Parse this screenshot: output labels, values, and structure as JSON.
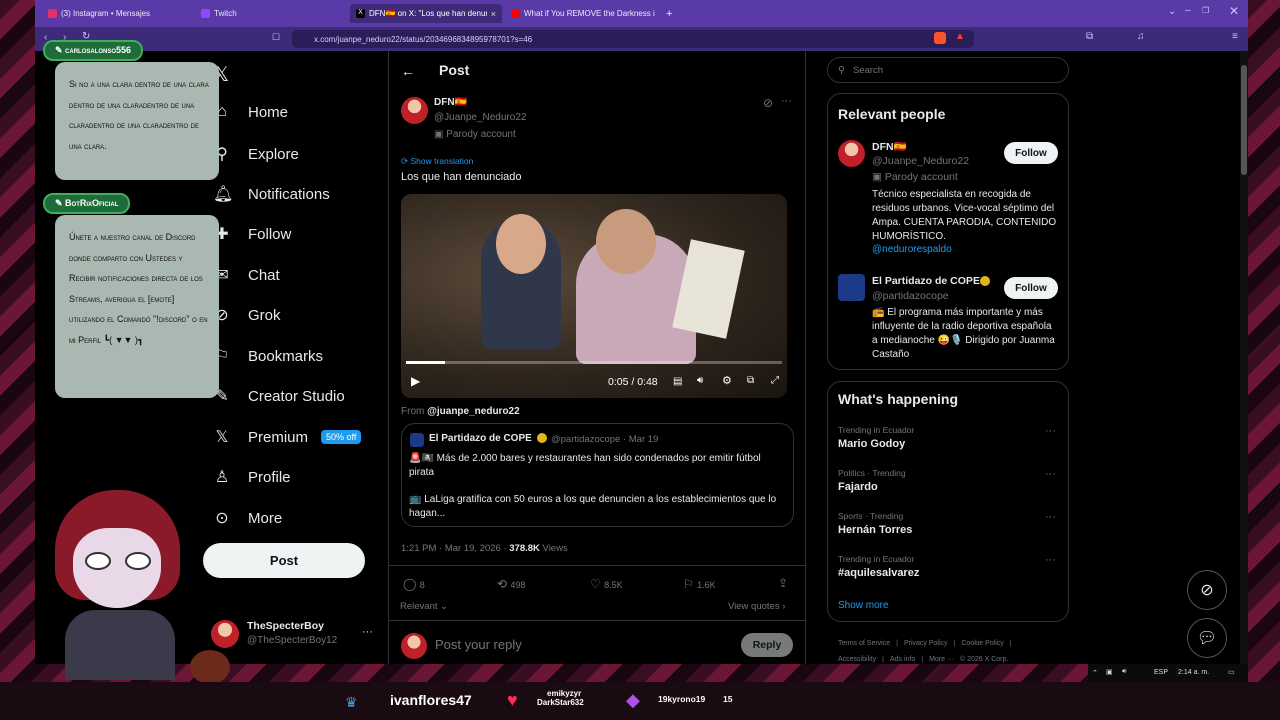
{
  "browser": {
    "tabs": [
      {
        "label": "(3) Instagram • Mensajes",
        "color": "#e1306c"
      },
      {
        "label": "Twitch",
        "color": "#9146ff"
      },
      {
        "label": "DFN🇪🇸 on X: \"Los que han denun",
        "color": "#222222"
      },
      {
        "label": "What if You REMOVE the Darkness in",
        "color": "#ff0000"
      }
    ],
    "new_tab": "+",
    "url": "x.com/juanpe_neduro22/status/2034696834895978701?s=46"
  },
  "nav": {
    "items": [
      "Home",
      "Explore",
      "Notifications",
      "Follow",
      "Chat",
      "Grok",
      "Bookmarks",
      "Creator Studio",
      "Premium",
      "Profile",
      "More"
    ],
    "premium_badge": "50% off",
    "post_button": "Post",
    "account_name": "TheSpecterBoy",
    "account_handle": "@TheSpecterBoy12"
  },
  "post": {
    "header": "Post",
    "author_name": "DFN🇪🇸",
    "author_handle": "@Juanpe_Neduro22",
    "parody": "Parody account",
    "show_translation": "Show translation",
    "text": "Los que han denunciado",
    "video_time": "0:05 / 0:48",
    "video_progress": 0.104,
    "from_label": "From",
    "from_handle": "@juanpe_neduro22",
    "quote": {
      "name": "El Partidazo de COPE",
      "handle": "@partidazocope · Mar 19",
      "line1": "🚨🏴‍☠️ Más de 2.000 bares y restaurantes han sido condenados por emitir fútbol pirata",
      "line2": "📺 LaLiga gratifica con 50 euros a los que denuncien a los establecimientos que lo hagan..."
    },
    "timestamp": "1:21 PM · Mar 19, 2026 ·",
    "views_count": "378.8K",
    "views_label": "Views",
    "replies": "8",
    "reposts": "498",
    "likes": "8.5K",
    "bookmarks": "1.6K",
    "relevant": "Relevant",
    "view_quotes": "View quotes",
    "reply_placeholder": "Post your reply",
    "reply_button": "Reply"
  },
  "sidebar": {
    "search_placeholder": "Search",
    "relevant_title": "Relevant people",
    "people": [
      {
        "name": "DFN🇪🇸",
        "handle": "@Juanpe_Neduro22",
        "sub": "Parody account",
        "bio": "Técnico especialista en recogida de residuos urbanos. Vice-vocal séptimo del Ampa. CUENTA PARODIA, CONTENIDO HUMORÍSTICO.",
        "link": "@nedurorespaldo",
        "follow": "Follow"
      },
      {
        "name": "El Partidazo de COPE",
        "handle": "@partidazocope",
        "bio": "📻 El programa más importante y más influyente de la radio deportiva española a medianoche 😜🎙️ Dirigido por Juanma Castaño",
        "follow": "Follow"
      }
    ],
    "happening_title": "What's happening",
    "trends": [
      {
        "context": "Trending in Ecuador",
        "name": "Mario Godoy"
      },
      {
        "context": "Politics · Trending",
        "name": "Fajardo"
      },
      {
        "context": "Sports · Trending",
        "name": "Hernán Torres"
      },
      {
        "context": "Trending in Ecuador",
        "name": "#aquilesalvarez"
      }
    ],
    "show_more": "Show more",
    "footer1": [
      "Terms of Service",
      "|",
      "Privacy Policy",
      "|",
      "Cookie Policy",
      "|"
    ],
    "footer2": [
      "Accessibility",
      "|",
      "Ads info",
      "|",
      "More ···",
      "© 2026 X Corp."
    ]
  },
  "stream_chat": [
    {
      "user": "carlosalonso556",
      "message": "Si no a una clara dentro de una clara dentro de una claradentro de una claradentro de una claradentro de una clara."
    },
    {
      "user": "BotRixOficial",
      "message": "Únete a nuestro canal de Discord donde comparto con Ustedes y Recibir notificaciones directa de los Streams, averigua el [emote] utilizando el Comandó \"!discord\" o en mi Perfil ┗( ▼▼ )┓"
    }
  ],
  "stream_bar": {
    "user1": "ivanflores47",
    "user2a": "emikyzyr",
    "user2b": "DarkStar632",
    "user3": "19kyrono19",
    "count": "15"
  },
  "taskbar": {
    "lang": "ESP",
    "time": "2:14 a. m."
  }
}
